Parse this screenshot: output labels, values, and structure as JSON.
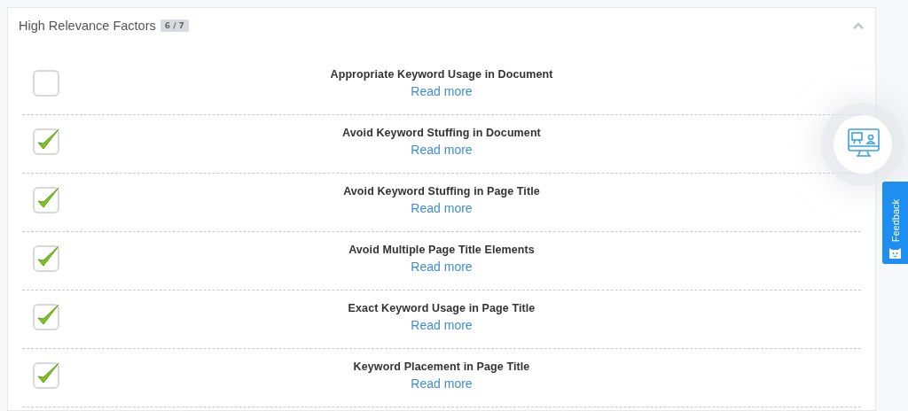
{
  "section": {
    "title": "High Relevance Factors",
    "badge": "6 / 7",
    "expanded": true
  },
  "factors": [
    {
      "name": "Appropriate Keyword Usage in Document",
      "link": "Read more",
      "checked": false
    },
    {
      "name": "Avoid Keyword Stuffing in Document",
      "link": "Read more",
      "checked": true
    },
    {
      "name": "Avoid Keyword Stuffing in Page Title",
      "link": "Read more",
      "checked": true
    },
    {
      "name": "Avoid Multiple Page Title Elements",
      "link": "Read more",
      "checked": true
    },
    {
      "name": "Exact Keyword Usage in Page Title",
      "link": "Read more",
      "checked": true
    },
    {
      "name": "Keyword Placement in Page Title",
      "link": "Read more",
      "checked": true
    }
  ],
  "feedback": {
    "label": "Feedback"
  }
}
